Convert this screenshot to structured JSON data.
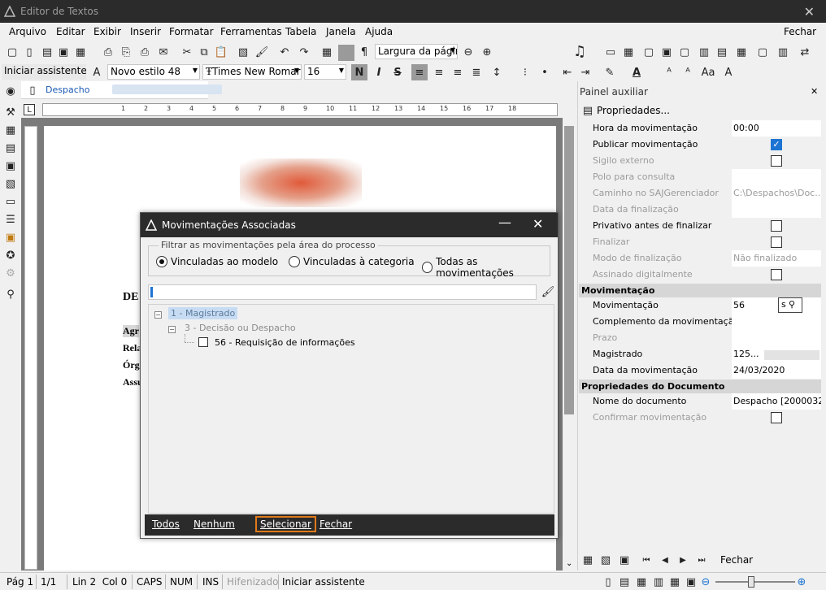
{
  "window": {
    "title": "Editor de Textos",
    "close_label": "✕"
  },
  "menu": {
    "items": [
      "Arquivo",
      "Editar",
      "Exibir",
      "Inserir",
      "Formatar",
      "Ferramentas",
      "Tabela",
      "Janela",
      "Ajuda"
    ],
    "close": "Fechar"
  },
  "toolbar": {
    "zoom_select": "Largura da págin",
    "assistant": "Iniciar assistente",
    "style_select": "Novo estilo 48",
    "font_select": "Times New Romar",
    "size_select": "16",
    "bold": "N",
    "italic": "I",
    "strike": "S",
    "pilcrow": "¶"
  },
  "doc_tab": {
    "name": "Despacho"
  },
  "ruler": {
    "marks": [
      "1",
      "2",
      "3",
      "4",
      "5",
      "6",
      "7",
      "8",
      "9",
      "10",
      "11",
      "12",
      "13",
      "14",
      "15",
      "16",
      "17",
      "18"
    ]
  },
  "doc_text": {
    "heading": "DE",
    "l1": "Agr",
    "l2": "Rela",
    "l3": "Órg",
    "l4": "Assu"
  },
  "pane": {
    "title": "Painel auxiliar",
    "close": "✕",
    "dropdown": "Propriedades...",
    "rows_top": [
      {
        "k": "Hora da movimentação",
        "v": "00:00",
        "dis": false
      },
      {
        "k": "Publicar movimentação",
        "chk": "on",
        "dis": false
      },
      {
        "k": "Sigilo externo",
        "chk": "off",
        "dis": true
      },
      {
        "k": "Polo para consulta",
        "v": "",
        "dis": true
      },
      {
        "k": "Caminho no SAJGerenciador",
        "v": "C:\\Despachos\\Doc...",
        "dis": true
      },
      {
        "k": "Data da finalização",
        "v": "",
        "dis": true
      },
      {
        "k": "Privativo antes de finalizar",
        "chk": "off",
        "dis": false
      },
      {
        "k": "Finalizar",
        "chk": "off",
        "dis": true
      },
      {
        "k": "Modo de finalização",
        "v": "Não finalizado",
        "dis": true
      },
      {
        "k": "Assinado digitalmente",
        "chk": "off",
        "dis": true
      }
    ],
    "section_mov": "Movimentação",
    "rows_mov": [
      {
        "k": "Movimentação",
        "v": "56",
        "dis": false
      },
      {
        "k": "Complemento da movimentação",
        "v": "",
        "dis": false
      },
      {
        "k": "Prazo",
        "v": "",
        "dis": true
      },
      {
        "k": "Magistrado",
        "v": "125...",
        "dis": false
      },
      {
        "k": "Data da movimentação",
        "v": "24/03/2020",
        "dis": false
      }
    ],
    "mov_btn": "s",
    "section_doc": "Propriedades do Documento",
    "rows_doc": [
      {
        "k": "Nome do documento",
        "v": "Despacho [2000032...",
        "dis": false
      },
      {
        "k": "Confirmar movimentação",
        "chk": "off",
        "dis": true
      }
    ],
    "bottom_close": "Fechar"
  },
  "dialog": {
    "title": "Movimentações Associadas",
    "group_label": "Filtrar as movimentações pela área do processo",
    "radios": [
      "Vinculadas ao modelo",
      "Vinculadas à categoria",
      "Todas as movimentações"
    ],
    "tree": {
      "root": "1 - Magistrado",
      "child": "3 - Decisão ou Despacho",
      "leaf": "56 - Requisição de informações"
    },
    "buttons": {
      "all": "Todos",
      "none": "Nenhum",
      "select": "Selecionar",
      "close": "Fechar"
    }
  },
  "status": {
    "page": "Pág 1",
    "pages": "1/1",
    "linecol": "Lin 2  Col 0",
    "caps": "CAPS",
    "num": "NUM",
    "ins": "INS",
    "hyph": "Hifenizado",
    "assistant": "Iniciar assistente"
  }
}
